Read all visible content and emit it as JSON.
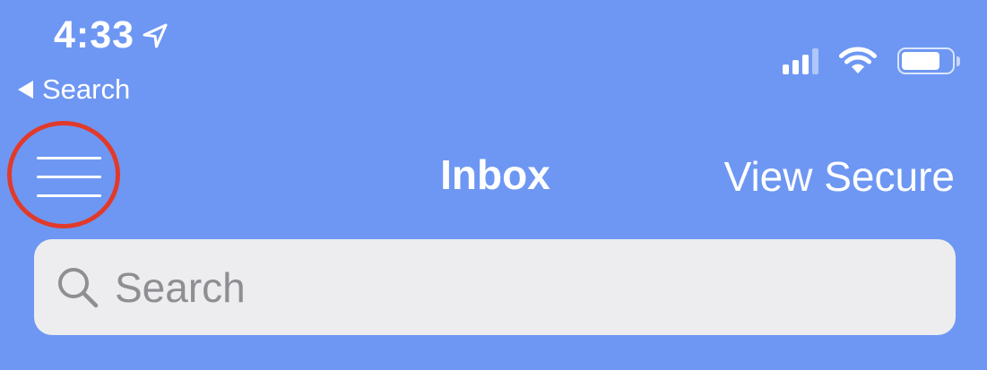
{
  "status_bar": {
    "time": "4:33",
    "location_icon": "location-arrow-icon",
    "back_label": "Search",
    "signal_bars": 4,
    "signal_active": 3,
    "battery_level": 0.78,
    "icons": [
      "cellular-signal-icon",
      "wifi-icon",
      "battery-icon"
    ]
  },
  "nav": {
    "menu_icon": "hamburger-menu-icon",
    "title": "Inbox",
    "right_action": "View Secure",
    "highlight_color": "#E23A2A"
  },
  "search": {
    "placeholder": "Search",
    "value": "",
    "icon": "search-icon"
  },
  "colors": {
    "background": "#6E97F3",
    "search_field": "#EDEDEF",
    "placeholder": "#8E8E93"
  }
}
